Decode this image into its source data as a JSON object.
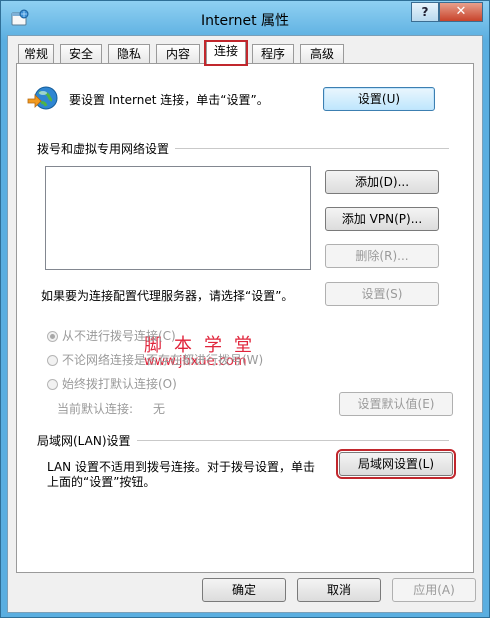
{
  "window": {
    "title": "Internet 属性",
    "help_label": "?",
    "close_label": "✕"
  },
  "tabs": [
    {
      "label": "常规"
    },
    {
      "label": "安全"
    },
    {
      "label": "隐私"
    },
    {
      "label": "内容"
    },
    {
      "label": "连接"
    },
    {
      "label": "程序"
    },
    {
      "label": "高级"
    }
  ],
  "setup": {
    "text": "要设置 Internet 连接，单击“设置”。",
    "button": "设置(U)"
  },
  "dialup": {
    "group_title": "拨号和虚拟专用网络设置",
    "add_button": "添加(D)...",
    "add_vpn_button": "添加 VPN(P)...",
    "remove_button": "删除(R)...",
    "proxy_text": "如果要为连接配置代理服务器，请选择“设置”。",
    "settings_button": "设置(S)",
    "radio_never": "从不进行拨号连接(C)",
    "radio_when_no_network": "不论网络连接是否存在都进行拨号(W)",
    "radio_always": "始终拨打默认连接(O)",
    "current_default_label": "当前默认连接:",
    "current_default_value": "无",
    "set_default_button": "设置默认值(E)"
  },
  "watermark": {
    "cn": "脚本学堂",
    "url": "www.jbxue.com"
  },
  "lan": {
    "group_title": "局域网(LAN)设置",
    "description_line1": "LAN 设置不适用到拨号连接。对于拨号设置，单击",
    "description_line2": "上面的“设置”按钮。",
    "button": "局域网设置(L)"
  },
  "footer": {
    "ok": "确定",
    "cancel": "取消",
    "apply": "应用(A)"
  },
  "colors": {
    "highlight": "#c1272d",
    "watermark": "#e0243b"
  }
}
